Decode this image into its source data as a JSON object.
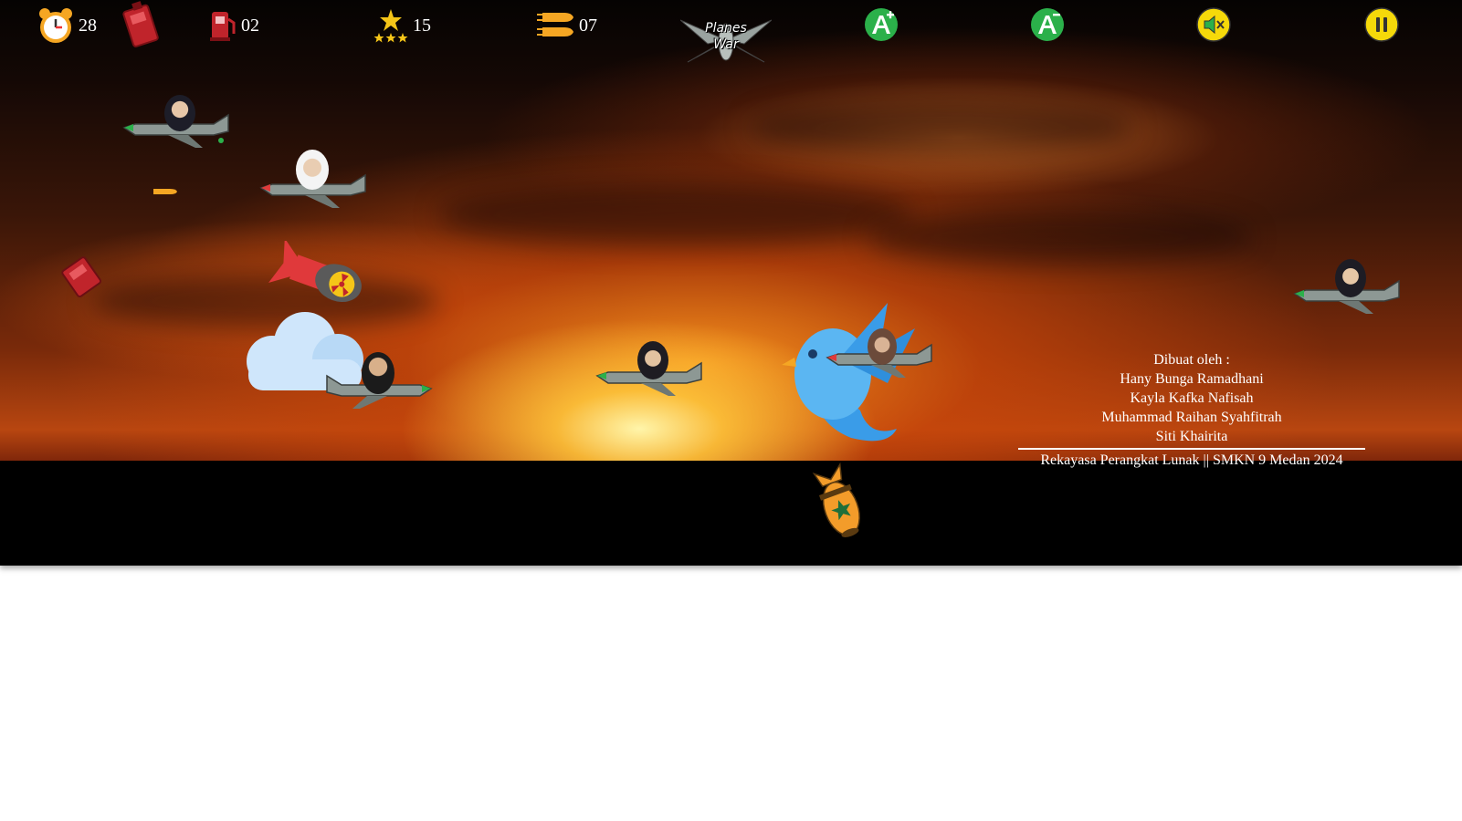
{
  "hud": {
    "timer_value": "28",
    "fuel_value": "02",
    "stars_value": "15",
    "ammo_value": "07"
  },
  "logo": {
    "line1": "Planes",
    "line2": "War"
  },
  "controls": {
    "font_increase_icon": "font-size-increase-icon",
    "font_decrease_icon": "font-size-decrease-icon",
    "mute_icon": "speaker-muted-icon",
    "pause_icon": "pause-icon"
  },
  "credits": {
    "heading": "Dibuat oleh :",
    "authors": [
      "Hany Bunga Ramadhani",
      "Kayla Kafka Nafisah",
      "Muhammad Raihan Syahfitrah",
      "Siti Khairita"
    ],
    "footer": "Rekayasa Perangkat Lunak || SMKN 9 Medan 2024"
  },
  "colors": {
    "hud_text": "#ffffff",
    "control_green": "#2bb04a",
    "control_yellow": "#f5d90a",
    "sky_orange": "#f08a1c"
  }
}
